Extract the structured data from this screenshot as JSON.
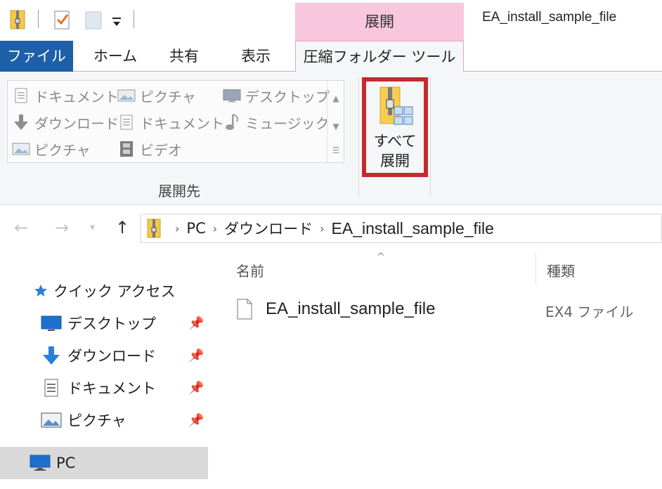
{
  "window": {
    "title": "EA_install_sample_file",
    "contextual_tab_header": "展開"
  },
  "tabs": {
    "file": "ファイル",
    "home": "ホーム",
    "share": "共有",
    "view": "表示",
    "compressed_tools": "圧縮フォルダー ツール"
  },
  "ribbon": {
    "destinations": [
      {
        "label": "ドキュメント",
        "icon": "document-icon"
      },
      {
        "label": "ピクチャ",
        "icon": "picture-icon"
      },
      {
        "label": "デスクトップ",
        "icon": "desktop-icon"
      },
      {
        "label": "ダウンロード",
        "icon": "download-icon"
      },
      {
        "label": "ドキュメント",
        "icon": "document-icon"
      },
      {
        "label": "ミュージック",
        "icon": "music-icon"
      },
      {
        "label": "ピクチャ",
        "icon": "picture-icon"
      },
      {
        "label": "ビデオ",
        "icon": "video-icon"
      }
    ],
    "group_label": "展開先",
    "extract_all_line1": "すべて",
    "extract_all_line2": "展開",
    "highlight_color": "#c32a2f"
  },
  "address": {
    "crumbs": [
      "PC",
      "ダウンロード",
      "EA_install_sample_file"
    ]
  },
  "navpane": {
    "quick_access": "クイック アクセス",
    "items": [
      {
        "label": "デスクトップ",
        "icon": "desktop-icon"
      },
      {
        "label": "ダウンロード",
        "icon": "download-icon"
      },
      {
        "label": "ドキュメント",
        "icon": "document-icon"
      },
      {
        "label": "ピクチャ",
        "icon": "picture-icon"
      }
    ],
    "pc": "PC"
  },
  "content": {
    "col_name": "名前",
    "col_type": "種類",
    "files": [
      {
        "name": "EA_install_sample_file",
        "type": "EX4 ファイル"
      }
    ]
  },
  "colors": {
    "file_tab": "#1d5fa8",
    "contextual_tab": "#f8c6dd",
    "accent_blue": "#1e6fd0"
  }
}
